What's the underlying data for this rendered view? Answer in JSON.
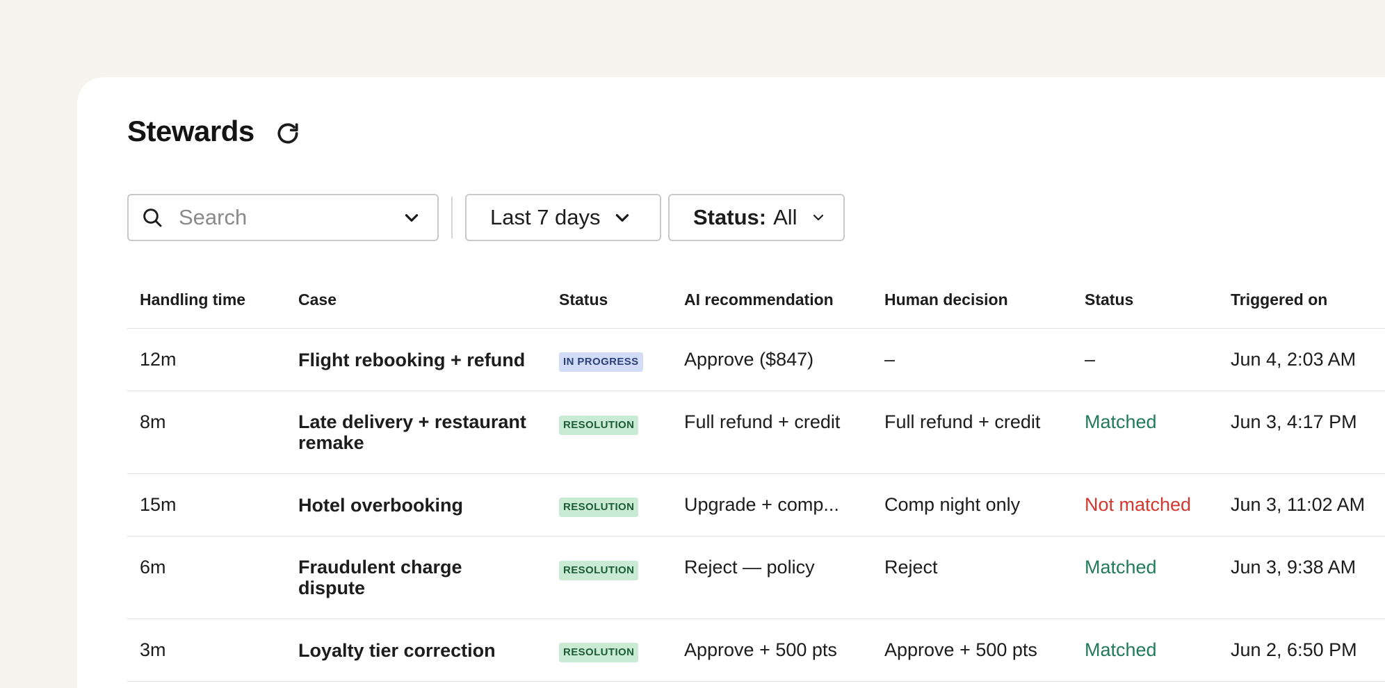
{
  "header": {
    "title": "Stewards"
  },
  "filters": {
    "search_placeholder": "Search",
    "date_range": "Last 7 days",
    "status_key": "Status:",
    "status_value": "All"
  },
  "table": {
    "columns": [
      "Handling time",
      "Case",
      "Status",
      "AI recommendation",
      "Human decision",
      "Status",
      "Triggered on"
    ],
    "rows": [
      {
        "handling_time": "12m",
        "case": "Flight rebooking + refund",
        "status": "IN PROGRESS",
        "ai_recommendation": "Approve ($847)",
        "human_decision": "–",
        "match_status": "–",
        "triggered_on": "Jun 4, 2:03 AM"
      },
      {
        "handling_time": "8m",
        "case": "Late delivery + restaurant remake",
        "status": "RESOLUTION",
        "ai_recommendation": "Full refund + credit",
        "human_decision": "Full refund + credit",
        "match_status": "Matched",
        "triggered_on": "Jun 3, 4:17 PM"
      },
      {
        "handling_time": "15m",
        "case": "Hotel overbooking",
        "status": "RESOLUTION",
        "ai_recommendation": "Upgrade + comp...",
        "human_decision": "Comp night only",
        "match_status": "Not matched",
        "triggered_on": "Jun 3, 11:02 AM"
      },
      {
        "handling_time": "6m",
        "case": "Fraudulent charge dispute",
        "status": "RESOLUTION",
        "ai_recommendation": "Reject — policy",
        "human_decision": "Reject",
        "match_status": "Matched",
        "triggered_on": "Jun 3, 9:38 AM"
      },
      {
        "handling_time": "3m",
        "case": "Loyalty tier correction",
        "status": "RESOLUTION",
        "ai_recommendation": "Approve + 500 pts",
        "human_decision": "Approve + 500 pts",
        "match_status": "Matched",
        "triggered_on": "Jun 2, 6:50 PM"
      }
    ]
  },
  "colors": {
    "background": "#f5f4ef",
    "matched": "#227a5c",
    "not_matched": "#d4372f",
    "badge_progress_bg": "#d3dcf6",
    "badge_resolution_bg": "#c9ebd3"
  },
  "icons": {
    "refresh": "refresh-icon",
    "search": "search-icon",
    "chevron": "chevron-down-icon"
  }
}
